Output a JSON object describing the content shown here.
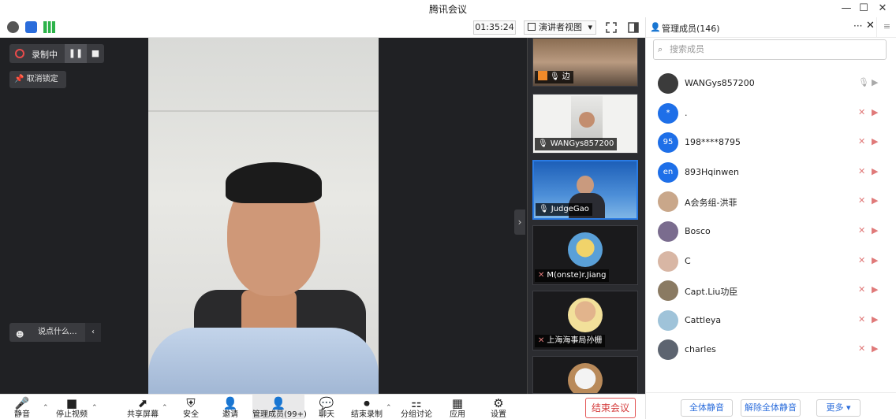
{
  "window": {
    "title": "腾讯会议",
    "minimize": "—",
    "maximize": "☐",
    "close": "✕"
  },
  "toolbar": {
    "timer": "01:35:24",
    "view_mode": "演讲者视图",
    "view_caret": "▾"
  },
  "stage": {
    "recording_label": "录制中",
    "pause_symbol": "❚❚",
    "stop_symbol": "■",
    "unlock_label": "取消锁定",
    "chat_placeholder": "说点什么...",
    "chat_collapse": "‹",
    "side_collapse": "›"
  },
  "thumbnails": [
    {
      "name": "边"
    },
    {
      "name": "WANGys857200"
    },
    {
      "name": "JudgeGao"
    },
    {
      "name": "M(onste)r.Jiang"
    },
    {
      "name": "上海海事局孙栅"
    },
    {
      "name": ""
    }
  ],
  "panel": {
    "title": "管理成员(146)",
    "more": "···",
    "close": "✕",
    "side_toggle": "≡",
    "search_placeholder": "搜索成员",
    "members": [
      {
        "name": "WANGys857200",
        "avatar_text": "",
        "avatar_color": "#3b3b3b",
        "muted": false
      },
      {
        "name": ".",
        "avatar_text": "*",
        "avatar_color": "#1e6fe8",
        "muted": true
      },
      {
        "name": "198****8795",
        "avatar_text": "95",
        "avatar_color": "#1e6fe8",
        "muted": true
      },
      {
        "name": "893Hqinwen",
        "avatar_text": "en",
        "avatar_color": "#1e6fe8",
        "muted": true
      },
      {
        "name": "A会务组-洪菲",
        "avatar_text": "",
        "avatar_color": "#c9a78a",
        "muted": true
      },
      {
        "name": "Bosco",
        "avatar_text": "",
        "avatar_color": "#7a6c8e",
        "muted": true
      },
      {
        "name": "C",
        "avatar_text": "",
        "avatar_color": "#d8b6a4",
        "muted": true
      },
      {
        "name": "Capt.Liu功臣",
        "avatar_text": "",
        "avatar_color": "#8a7a62",
        "muted": true
      },
      {
        "name": "Cattleya",
        "avatar_text": "",
        "avatar_color": "#9fc3d9",
        "muted": true
      },
      {
        "name": "charles",
        "avatar_text": "",
        "avatar_color": "#5d6470",
        "muted": true
      }
    ],
    "mute_all": "全体静音",
    "unmute_all": "解除全体静音",
    "more_button": "更多 ▾"
  },
  "controls": {
    "mute": "静音",
    "stop_video": "停止视频",
    "share_screen": "共享屏幕",
    "security": "安全",
    "invite": "邀请",
    "manage_members": "管理成员(99+)",
    "chat": "聊天",
    "end_recording": "结束录制",
    "breakout": "分组讨论",
    "apps": "应用",
    "settings": "设置",
    "end_meeting": "结束会议"
  },
  "colors": {
    "accent_blue": "#1e6fe8",
    "danger_red": "#d43b3b",
    "stage_bg": "#202124"
  }
}
